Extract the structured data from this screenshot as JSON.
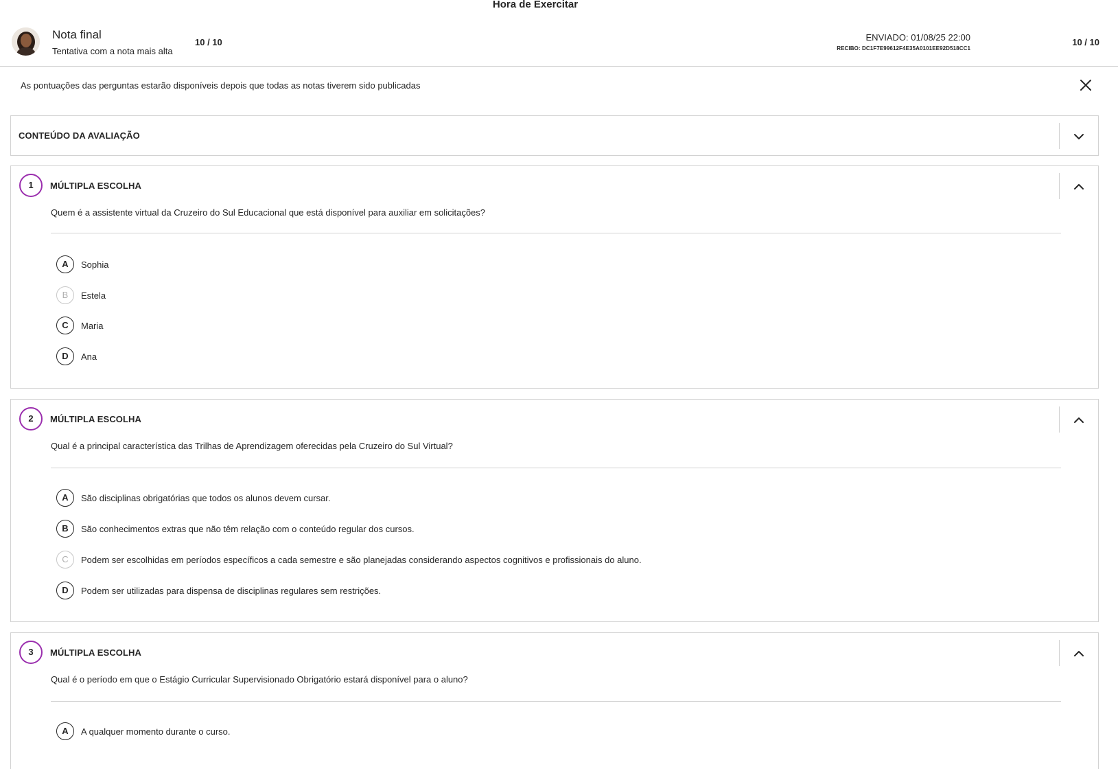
{
  "page_title": "Hora de Exercitar",
  "header": {
    "grade_label": "Nota final",
    "grade_sub": "Tentativa com a nota mais alta",
    "grade_score": "10 / 10",
    "sent": "ENVIADO: 01/08/25 22:00",
    "receipt": "RECIBO: DC1F7E99612F4E35A0101EE92D518CC1",
    "attempt_score": "10 / 10"
  },
  "notice": "As pontuações das perguntas estarão disponíveis depois que todas as notas tiverem sido publicadas",
  "content_section": {
    "title": "CONTEÚDO DA AVALIAÇÃO",
    "toggle_icon": "chevron-down-icon"
  },
  "questions": [
    {
      "number": "1",
      "type": "MÚLTIPLA ESCOLHA",
      "text": "Quem é a assistente virtual da Cruzeiro do Sul Educacional que está disponível para auxiliar em solicitações?",
      "options": [
        {
          "letter": "A",
          "text": "Sophia",
          "state": "normal"
        },
        {
          "letter": "B",
          "text": "Estela",
          "state": "faded"
        },
        {
          "letter": "C",
          "text": "Maria",
          "state": "normal"
        },
        {
          "letter": "D",
          "text": "Ana",
          "state": "normal"
        }
      ]
    },
    {
      "number": "2",
      "type": "MÚLTIPLA ESCOLHA",
      "text": "Qual é a principal característica das Trilhas de Aprendizagem oferecidas pela Cruzeiro do Sul Virtual?",
      "options": [
        {
          "letter": "A",
          "text": "São disciplinas obrigatórias que todos os alunos devem cursar.",
          "state": "normal"
        },
        {
          "letter": "B",
          "text": "São conhecimentos extras que não têm relação com o conteúdo regular dos cursos.",
          "state": "normal"
        },
        {
          "letter": "C",
          "text": "Podem ser escolhidas em períodos específicos a cada semestre e são planejadas considerando aspectos cognitivos e profissionais do aluno.",
          "state": "faded"
        },
        {
          "letter": "D",
          "text": "Podem ser utilizadas para dispensa de disciplinas regulares sem restrições.",
          "state": "normal"
        }
      ]
    },
    {
      "number": "3",
      "type": "MÚLTIPLA ESCOLHA",
      "text": "Qual é o período em que o Estágio Curricular Supervisionado Obrigatório estará disponível para o aluno?",
      "options": [
        {
          "letter": "A",
          "text": "A qualquer momento durante o curso.",
          "state": "normal"
        }
      ]
    }
  ],
  "colors": {
    "accent": "#9b2fae",
    "border": "#d2d2d2",
    "text": "#262626",
    "faded": "#c8c8c8"
  }
}
